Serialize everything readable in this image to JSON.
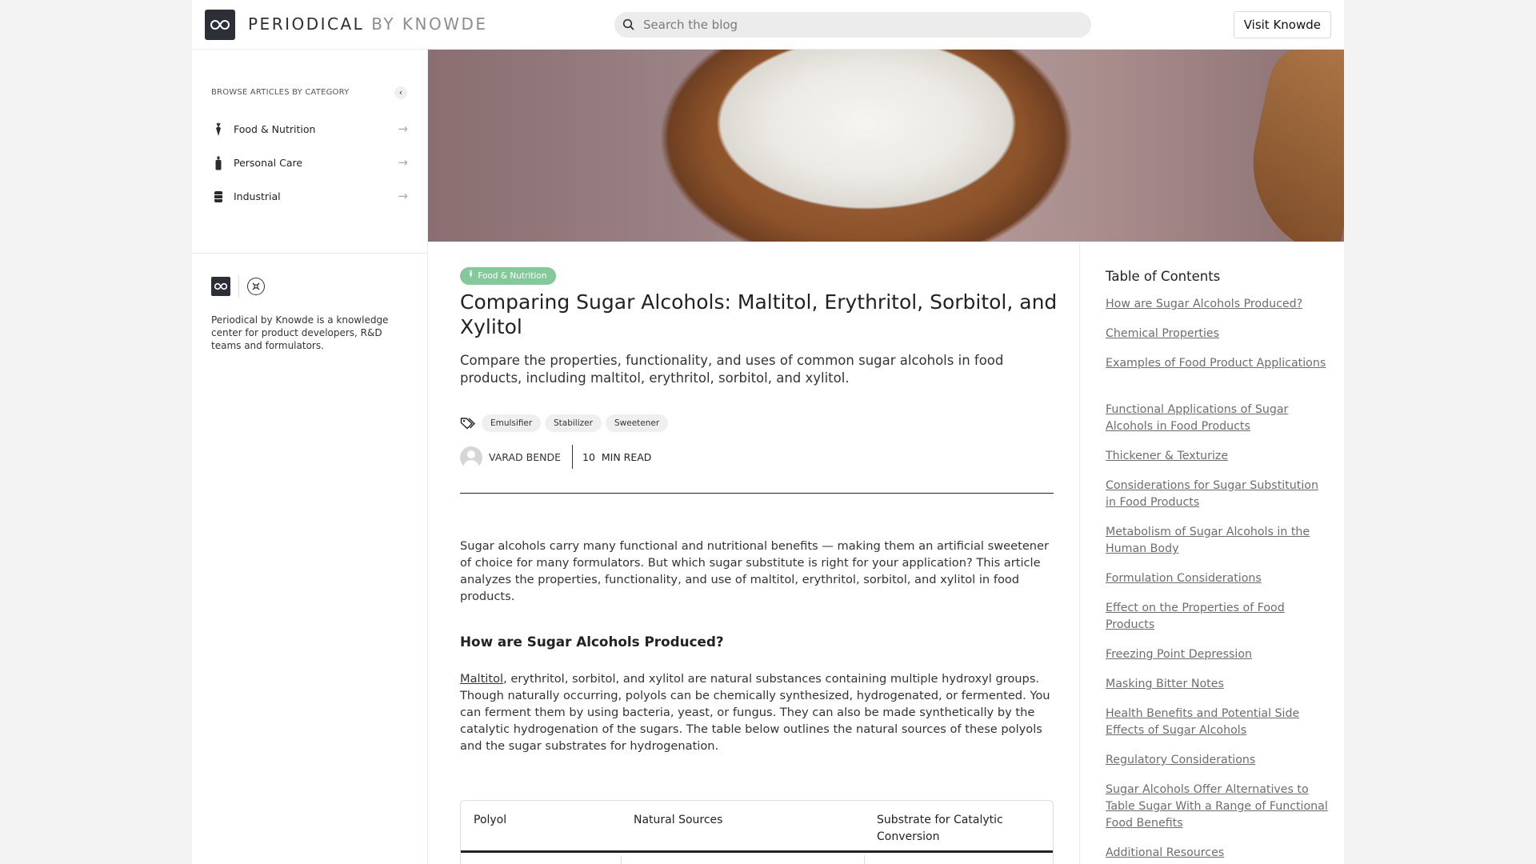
{
  "header": {
    "brand_main": "PERIODICAL",
    "brand_sub": "BY KNOWDE",
    "search_placeholder": "Search the blog",
    "visit_button": "Visit Knowde"
  },
  "sidebar": {
    "browse_title": "BROWSE ARTICLES BY CATEGORY",
    "collapse_glyph": "‹",
    "categories": [
      {
        "label": "Food & Nutrition",
        "icon": "carrot-icon"
      },
      {
        "label": "Personal Care",
        "icon": "bottle-icon"
      },
      {
        "label": "Industrial",
        "icon": "barrel-icon"
      }
    ],
    "arrow_glyph": "→",
    "about": "Periodical by Knowde is a knowledge center for product developers, R&D teams and formulators."
  },
  "article": {
    "category_badge": "Food & Nutrition",
    "title": "Comparing Sugar Alcohols: Maltitol, Erythritol, Sorbitol, and Xylitol",
    "summary": "Compare the properties, functionality, and uses of common sugar alcohols in food products, including maltitol, erythritol, sorbitol, and xylitol.",
    "tags": [
      "Emulsifier",
      "Stabilizer",
      "Sweetener"
    ],
    "author": "VARAD BENDE",
    "read_time": "10  MIN READ",
    "intro": "Sugar alcohols carry many functional and nutritional benefits — making them an artificial sweetener of choice for many formulators. But which sugar substitute is right for your application? This article analyzes the properties, functionality, and use of maltitol, erythritol, sorbitol, and xylitol in food products.",
    "section_heading": "How are Sugar Alcohols Produced?",
    "para_link": "Maltitol",
    "para_rest": ", erythritol, sorbitol, and xylitol are natural substances containing multiple hydroxyl groups. Though naturally occurring, polyols can be chemically synthesized, hydrogenated, or fermented. You can ferment them by using bacteria, yeast, or fungus. They can also be made synthetically by the catalytic hydrogenation of the sugars. The table below outlines the natural sources of these polyols and the sugar substrates for hydrogenation.",
    "table_headers": [
      "Polyol",
      "Natural Sources",
      "Substrate for Catalytic Conversion"
    ]
  },
  "toc": {
    "title": "Table of Contents",
    "items": [
      "How are Sugar Alcohols Produced? ",
      "Chemical Properties ",
      "Examples of Food Product Applications",
      "Functional Applications of Sugar Alcohols in Food Products",
      "Thickener & Texturize",
      "Considerations for Sugar Substitution in Food Products",
      "Metabolism of Sugar Alcohols in the Human Body",
      "Formulation Considerations",
      "Effect on the Properties of Food Products",
      "Freezing Point Depression",
      "Masking Bitter Notes",
      "Health Benefits and Potential Side Effects of Sugar Alcohols",
      "Regulatory Considerations",
      "Sugar Alcohols Offer Alternatives to Table Sugar With a Range of Functional Food Benefits",
      "Additional Resources"
    ]
  },
  "colors": {
    "badge_green": "#84c99a",
    "logo_dark": "#2c3036",
    "toc_link": "#6d6d6d"
  }
}
